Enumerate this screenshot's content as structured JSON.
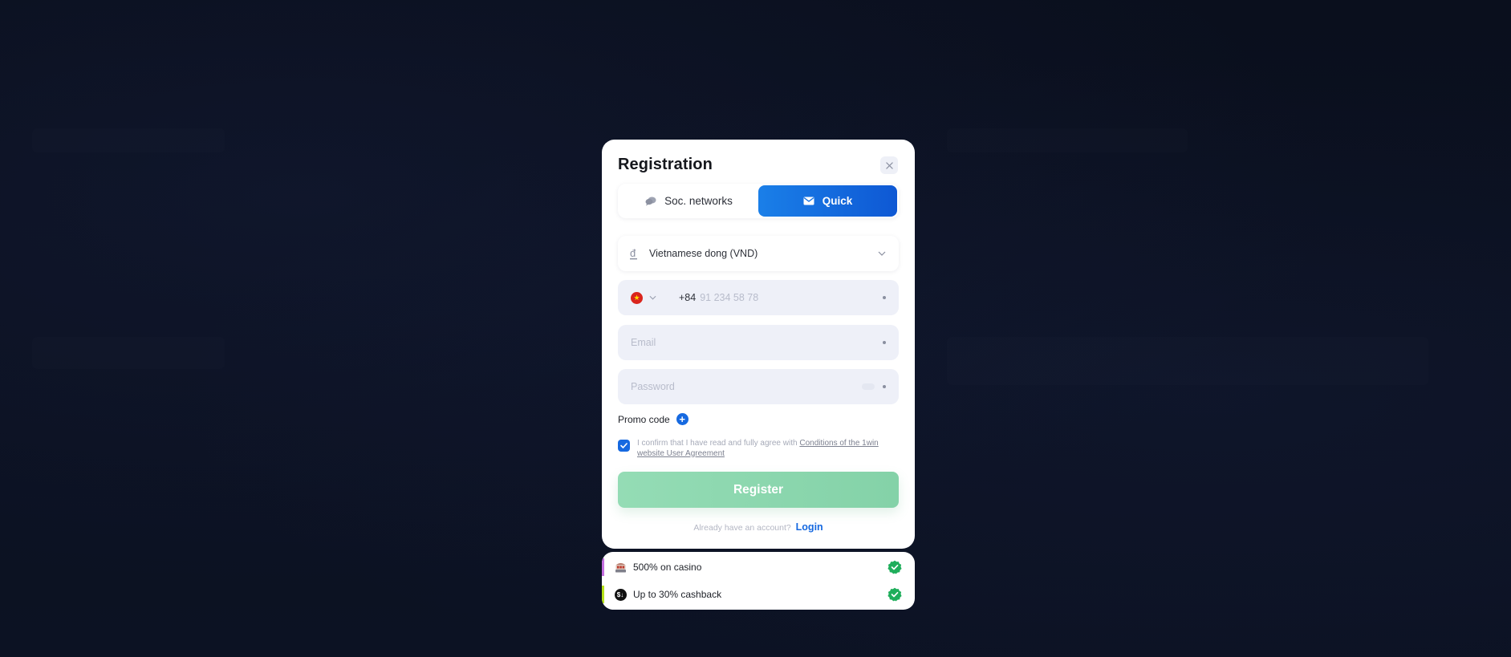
{
  "modal": {
    "title": "Registration",
    "tabs": [
      {
        "label": "Soc. networks",
        "icon": "chat-bubbles-icon",
        "active": false
      },
      {
        "label": "Quick",
        "icon": "envelope-icon",
        "active": true
      }
    ],
    "currency": {
      "icon": "dong-icon",
      "label": "Vietnamese dong (VND)"
    },
    "phone": {
      "country_flag": "vietnam-flag",
      "code": "+84",
      "placeholder": "91 234 58 78"
    },
    "email": {
      "placeholder": "Email"
    },
    "password": {
      "placeholder": "Password"
    },
    "promo": {
      "label": "Promo code"
    },
    "agreement": {
      "checked": true,
      "text": "I confirm that I have read and fully agree with ",
      "link": "Conditions of the 1win website User Agreement"
    },
    "register_label": "Register",
    "login_prompt": "Already have an account?",
    "login_label": "Login"
  },
  "bonuses": [
    {
      "label": "500% on casino",
      "icon": "slot-machine-icon",
      "accent": "#c46ee0",
      "checked": true
    },
    {
      "label": "Up to 30% cashback",
      "icon": "cashback-coin-icon",
      "accent": "#b6e21a",
      "checked": true
    }
  ],
  "colors": {
    "primary": "#1669e0",
    "register_disabled": "#8fd9b0",
    "success": "#1fae5b",
    "background": "#0b1020"
  }
}
